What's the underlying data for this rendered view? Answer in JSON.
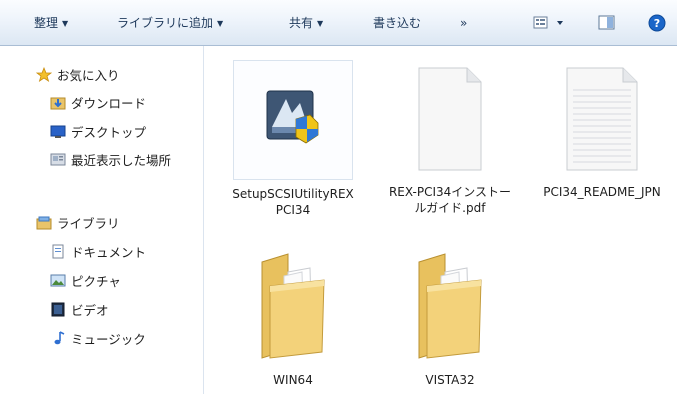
{
  "toolbar": {
    "organize": "整理",
    "add_to_library": "ライブラリに追加",
    "share": "共有",
    "burn": "書き込む",
    "more": "»"
  },
  "nav": {
    "favorites": {
      "label": "お気に入り",
      "items": [
        "ダウンロード",
        "デスクトップ",
        "最近表示した場所"
      ]
    },
    "libraries": {
      "label": "ライブラリ",
      "items": [
        "ドキュメント",
        "ピクチャ",
        "ビデオ",
        "ミュージック"
      ]
    }
  },
  "files": [
    {
      "name": "SetupSCSIUtilityREXPCI34",
      "type": "installer"
    },
    {
      "name": "REX-PCI34インストールガイド.pdf",
      "type": "pdf"
    },
    {
      "name": "PCI34_README_JPN",
      "type": "text"
    },
    {
      "name": "WIN64",
      "type": "folder"
    },
    {
      "name": "VISTA32",
      "type": "folder"
    }
  ],
  "colors": {
    "toolbar_text": "#1e395b",
    "folder": "#f3d27a",
    "help": "#1b66c9"
  }
}
